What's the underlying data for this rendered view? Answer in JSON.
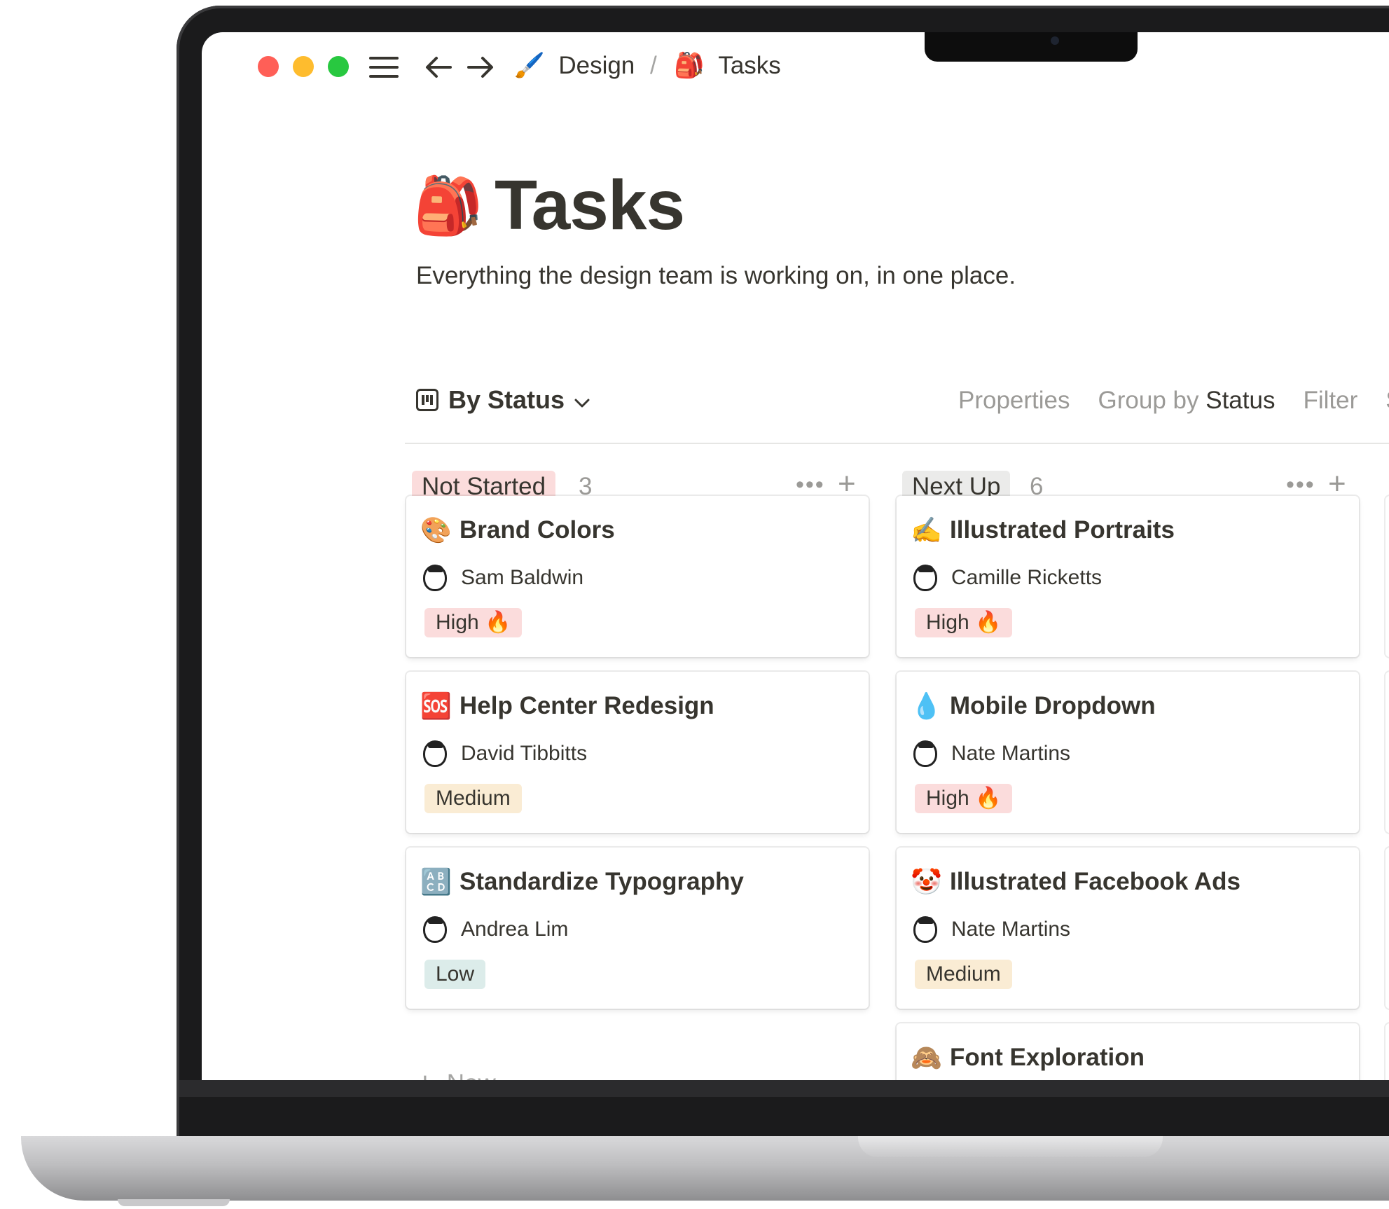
{
  "toolbar": {
    "traffic_colors": [
      "#ff5f57",
      "#febc2e",
      "#28c840"
    ],
    "icons": {
      "menu": "menu-icon",
      "back": "arrow-left-icon",
      "forward": "arrow-right-icon"
    },
    "breadcrumb": [
      {
        "emoji": "🖌️",
        "label": "Design"
      },
      {
        "emoji": "🎒",
        "label": "Tasks"
      }
    ],
    "separator": "/"
  },
  "page": {
    "icon": "🎒",
    "title": "Tasks",
    "description": "Everything the design team is working on, in one place."
  },
  "view": {
    "name": "By Status",
    "actions": {
      "properties": "Properties",
      "group_by_prefix": "Group by",
      "group_by_value": "Status",
      "filter": "Filter",
      "truncated": "S"
    }
  },
  "columns": [
    {
      "status": "Not Started",
      "count": "3",
      "status_color": "#fbdcdc",
      "cards": [
        {
          "emoji": "🎨",
          "title": "Brand Colors",
          "person": "Sam Baldwin",
          "priority": "High 🔥",
          "priority_level": "high"
        },
        {
          "emoji": "🆘",
          "title": "Help Center Redesign",
          "person": "David Tibbitts",
          "priority": "Medium",
          "priority_level": "medium"
        },
        {
          "emoji": "🔠",
          "title": "Standardize Typography",
          "person": "Andrea Lim",
          "priority": "Low",
          "priority_level": "low"
        }
      ],
      "new_label": "New"
    },
    {
      "status": "Next Up",
      "count": "6",
      "status_color": "#ebebea",
      "cards": [
        {
          "emoji": "✍️",
          "title": "Illustrated Portraits",
          "person": "Camille Ricketts",
          "priority": "High 🔥",
          "priority_level": "high"
        },
        {
          "emoji": "💧",
          "title": "Mobile Dropdown",
          "person": "Nate Martins",
          "priority": "High 🔥",
          "priority_level": "high"
        },
        {
          "emoji": "🤡",
          "title": "Illustrated Facebook Ads",
          "person": "Nate Martins",
          "priority": "Medium",
          "priority_level": "medium"
        },
        {
          "emoji": "🙈",
          "title": "Font Exploration"
        }
      ]
    }
  ]
}
